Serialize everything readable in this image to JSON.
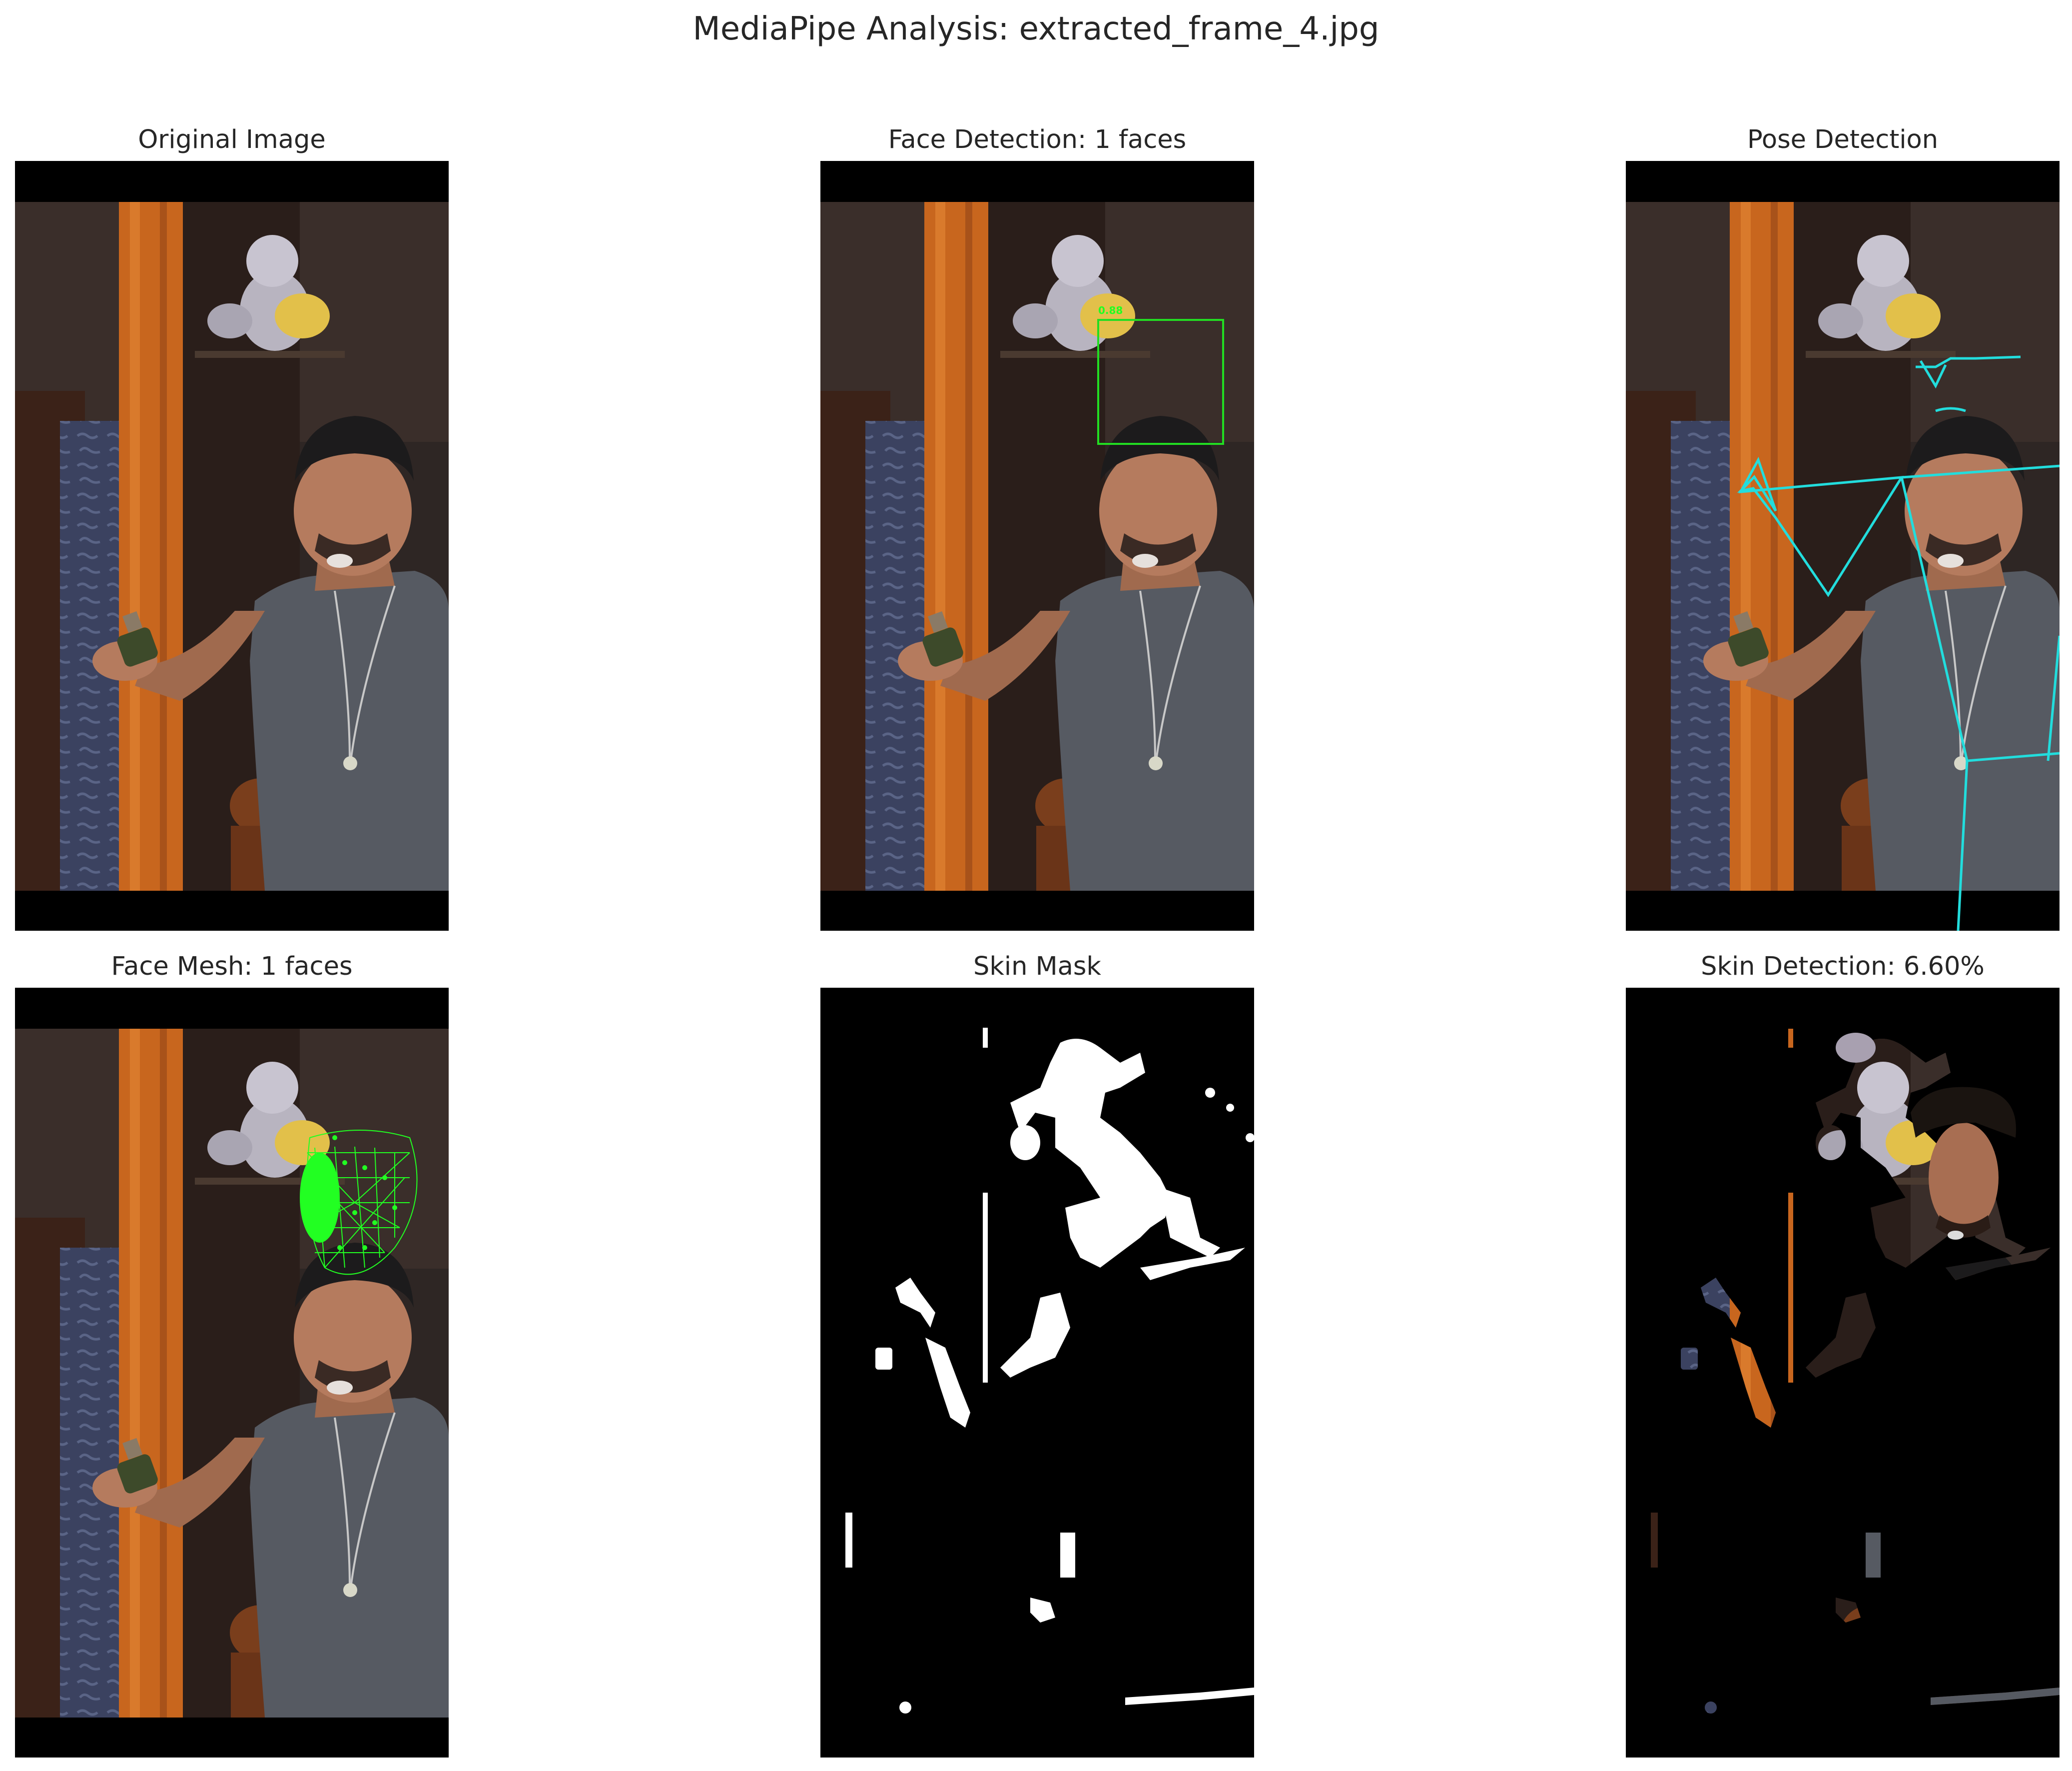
{
  "figure": {
    "suptitle": "MediaPipe Analysis: extracted_frame_4.jpg"
  },
  "panels": [
    {
      "id": "original",
      "title": "Original Image",
      "icon": "photo-icon"
    },
    {
      "id": "face-detection",
      "title": "Face Detection: 1 faces",
      "confidence_label": "0.88",
      "box_color": "#22dd22"
    },
    {
      "id": "pose-detection",
      "title": "Pose Detection",
      "skeleton_color": "#22dddd"
    },
    {
      "id": "face-mesh",
      "title": "Face Mesh: 1 faces",
      "mesh_color": "#22ff22"
    },
    {
      "id": "skin-mask",
      "title": "Skin Mask"
    },
    {
      "id": "skin-detection",
      "title": "Skin Detection: 6.60%",
      "skin_percent": 6.6
    }
  ],
  "colors": {
    "letterbox": "#000000",
    "wall": "#3a3f58",
    "pillar": "#c8661e",
    "shirt": "#585c63",
    "skin": "#b57b5e",
    "hair": "#1c1b1c",
    "mask_white": "#ffffff"
  }
}
